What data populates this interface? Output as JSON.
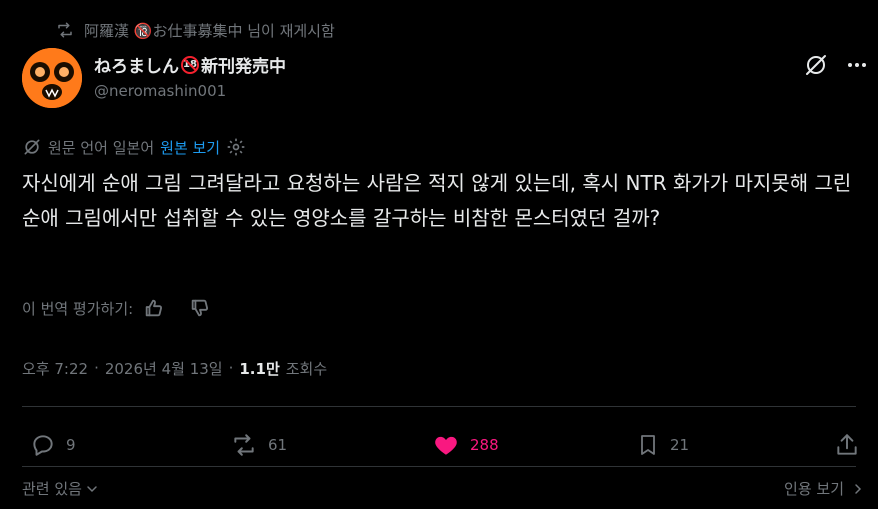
{
  "repost": {
    "text": "阿羅漢 🔞お仕事募集中 님이 재게시함"
  },
  "author": {
    "name_prefix": "ねろましん",
    "name_suffix": "新刊発売中",
    "badge": "18",
    "handle": "@neromashin001"
  },
  "translate": {
    "source_label": "원문 언어 일본어",
    "link_label": "원본 보기"
  },
  "tweet": {
    "text": "자신에게 순애 그림 그려달라고 요청하는 사람은 적지 않게 있는데, 혹시 NTR 화가가 마지못해 그린 순애 그림에서만 섭취할 수 있는 영양소를 갈구하는 비참한 몬스터였던 걸까?"
  },
  "rating": {
    "label": "이 번역 평가하기:"
  },
  "meta": {
    "time": "오후 7:22",
    "sep": "·",
    "date": "2026년 4월 13일",
    "views": "1.1만",
    "views_label": "조회수"
  },
  "actions": {
    "replies": "9",
    "reposts": "61",
    "likes": "288",
    "bookmarks": "21"
  },
  "colors": {
    "accent": "#1d9bf0",
    "like": "#f91880",
    "muted": "#71767b",
    "text": "#e7e9ea",
    "background": "#000000"
  },
  "footer": {
    "related": "관련 있음",
    "quote": "인용 보기"
  }
}
